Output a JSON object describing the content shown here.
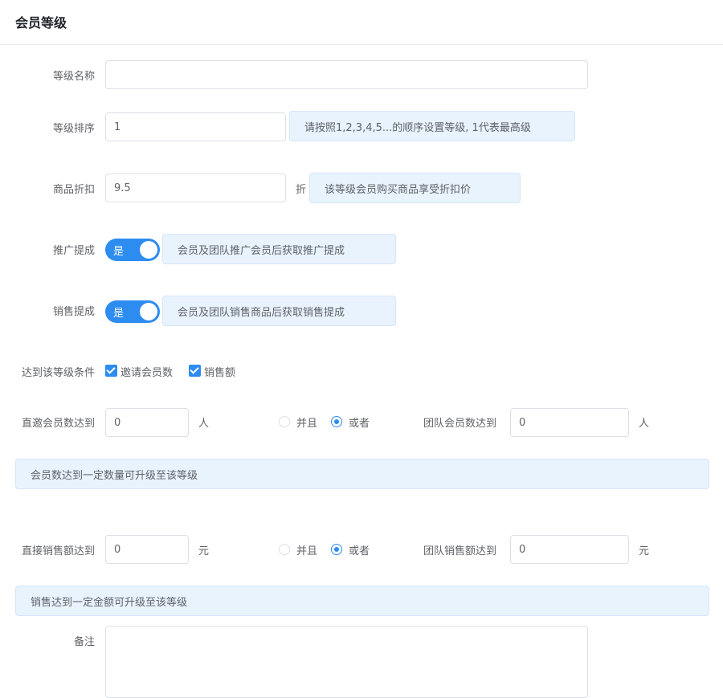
{
  "modal": {
    "title": "会员等级"
  },
  "form": {
    "level_name": {
      "label": "等级名称",
      "value": ""
    },
    "level_order": {
      "label": "等级排序",
      "value": "1",
      "tip": "请按照1,2,3,4,5...的顺序设置等级, 1代表最高级"
    },
    "discount": {
      "label": "商品折扣",
      "value": "9.5",
      "unit": "折",
      "tip": "该等级会员购买商品享受折扣价"
    },
    "promo_commission": {
      "label": "推广提成",
      "switch_text": "是",
      "enabled": true,
      "tip": "会员及团队推广会员后获取推广提成"
    },
    "sales_commission": {
      "label": "销售提成",
      "switch_text": "是",
      "enabled": true,
      "tip": "会员及团队销售商品后获取销售提成"
    },
    "conditions": {
      "label": "达到该等级条件",
      "options": [
        {
          "label": "邀请会员数",
          "checked": true
        },
        {
          "label": "销售额",
          "checked": true
        }
      ]
    },
    "members": {
      "direct_label": "直邀会员数达到",
      "direct_value": "0",
      "unit": "人",
      "logic": {
        "and_label": "并且",
        "or_label": "或者",
        "selected": "或者"
      },
      "team_label": "团队会员数达到",
      "team_value": "0",
      "team_unit": "人",
      "tip": "会员数达到一定数量可升级至该等级"
    },
    "sales": {
      "direct_label": "直接销售额达到",
      "direct_value": "0",
      "unit": "元",
      "logic": {
        "and_label": "并且",
        "or_label": "或者",
        "selected": "或者"
      },
      "team_label": "团队销售额达到",
      "team_value": "0",
      "team_unit": "元",
      "tip": "销售达到一定金额可升级至该等级"
    },
    "remark": {
      "label": "备注",
      "value": ""
    }
  },
  "colors": {
    "accent": "#2d8cf0",
    "tip_bg": "#e8f3fd",
    "border": "#dcdfe6"
  }
}
